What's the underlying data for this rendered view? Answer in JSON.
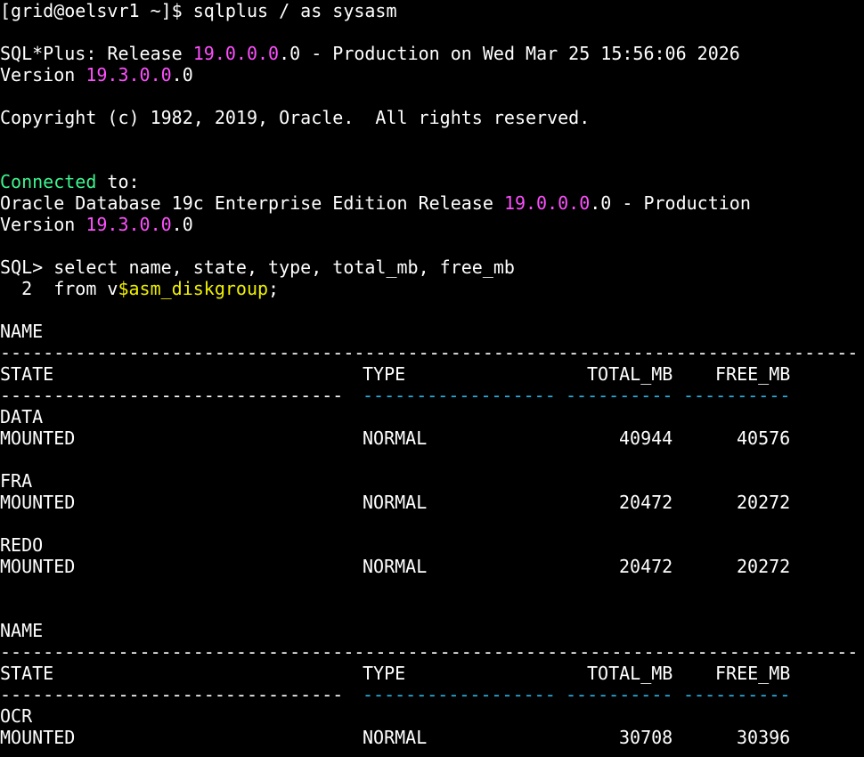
{
  "terminal": {
    "prompt_line": "[grid@oelsvr1 ~]$ sqlplus / as sysasm",
    "banner1": {
      "prefix": "SQL*Plus: Release ",
      "ver_highlight": "19.0.0.0",
      "ver_rest": ".0 - Production on Wed Mar 25 15:56:06 2026"
    },
    "banner2": {
      "prefix": "Version ",
      "ver_highlight": "19.3.0.0",
      "ver_rest": ".0"
    },
    "copyright": "Copyright (c) 1982, 2019, Oracle.  All rights reserved.",
    "connected": {
      "word": "Connected",
      "rest": " to:"
    },
    "db_banner1": {
      "prefix": "Oracle Database 19c Enterprise Edition Release ",
      "ver_highlight": "19.0.0.0",
      "ver_rest": ".0 - Production"
    },
    "db_banner2": {
      "prefix": "Version ",
      "ver_highlight": "19.3.0.0",
      "ver_rest": ".0"
    },
    "query_line1": "SQL> select name, state, type, total_mb, free_mb",
    "query_line2": {
      "prefix": "  2  from v",
      "highlight": "$asm_diskgroup",
      "suffix": ";"
    },
    "result_table": {
      "header_name": "NAME",
      "header_state": "STATE",
      "header_type": "TYPE",
      "header_total": "TOTAL_MB",
      "header_free": "FREE_MB",
      "dash_full": "--------------------------------------------------------------------------------",
      "dash_state": "--------------------------------",
      "dash_type": "------------------",
      "dash_total": "----------",
      "dash_free": "----------",
      "rows": [
        {
          "name": "DATA",
          "state": "MOUNTED",
          "type": "NORMAL",
          "total_mb": "40944",
          "free_mb": "40576"
        },
        {
          "name": "FRA",
          "state": "MOUNTED",
          "type": "NORMAL",
          "total_mb": "20472",
          "free_mb": "20272"
        },
        {
          "name": "REDO",
          "state": "MOUNTED",
          "type": "NORMAL",
          "total_mb": "20472",
          "free_mb": "20272"
        },
        {
          "name": "OCR",
          "state": "MOUNTED",
          "type": "NORMAL",
          "total_mb": "30708",
          "free_mb": "30396"
        }
      ]
    },
    "colors": {
      "background": "#000000",
      "text": "#ffffff",
      "version_highlight": "#ff4fff",
      "connected_green": "#3ef58f",
      "identifier_yellow": "#f0f000",
      "dash_cyan": "#28b4e6"
    }
  }
}
